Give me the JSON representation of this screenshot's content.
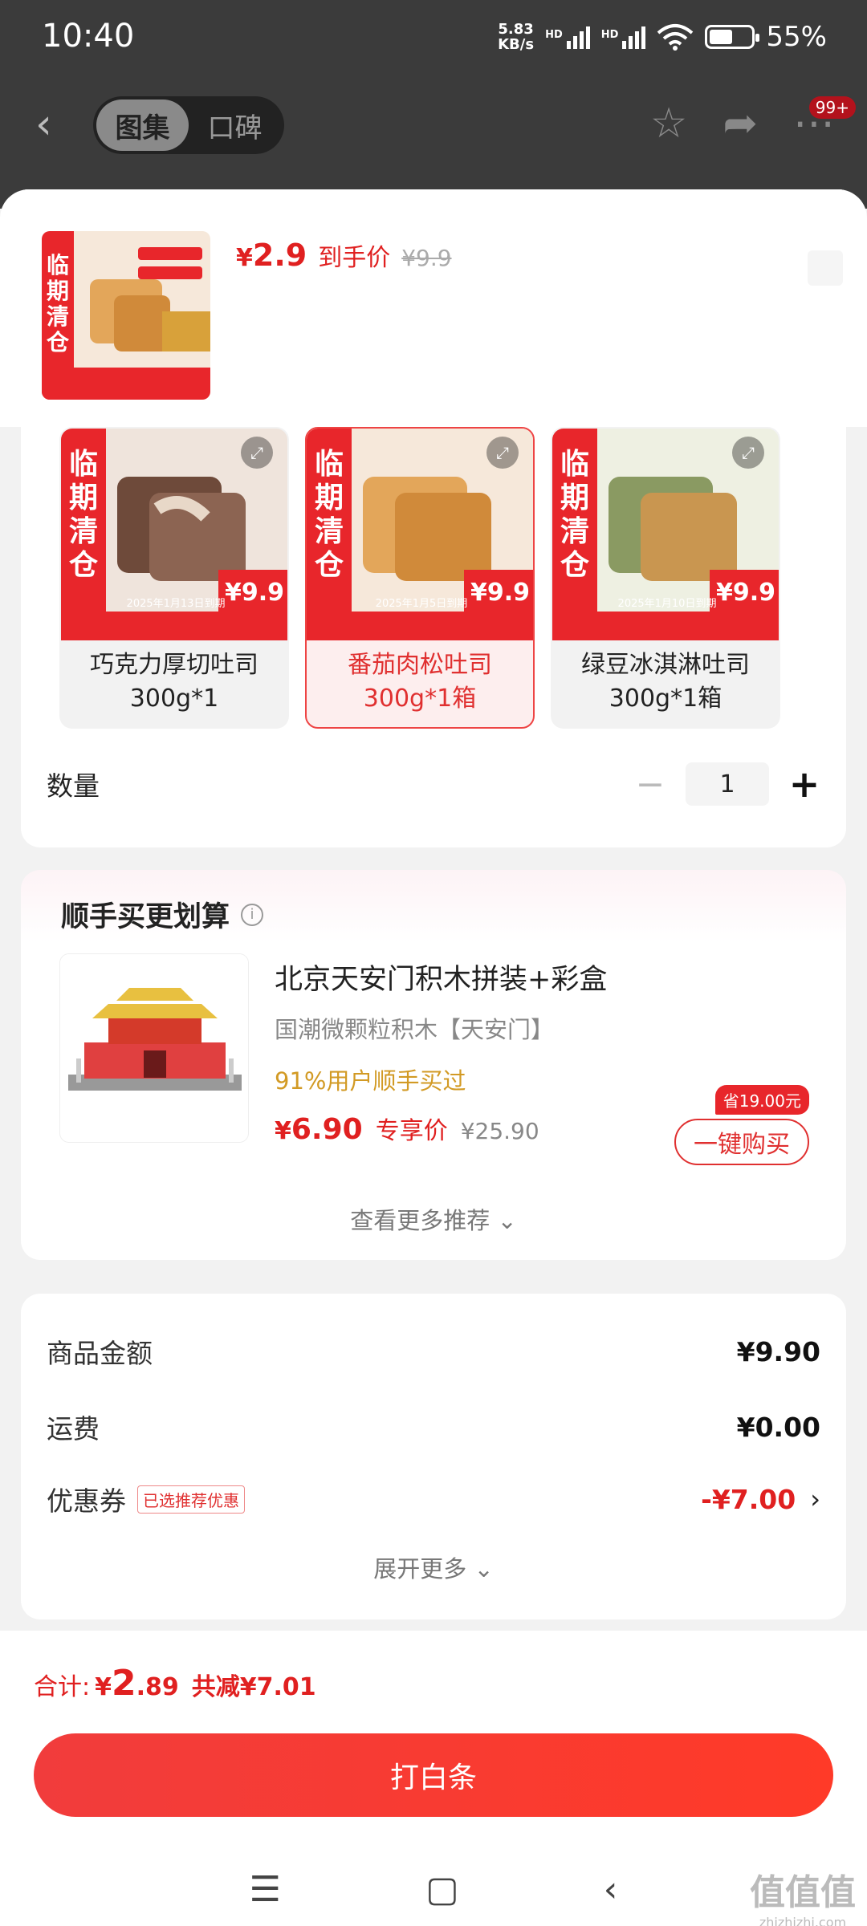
{
  "status_bar": {
    "time": "10:40",
    "net_speed_value": "5.83",
    "net_speed_unit": "KB/s",
    "hd_label": "HD",
    "battery": "55%"
  },
  "top_nav": {
    "tabs": [
      "图集",
      "口碑"
    ],
    "badge": "99+"
  },
  "product": {
    "price_currency": "¥",
    "price": "2.9",
    "price_tag": "到手价",
    "original_price": "¥9.9",
    "banner_text": "临期清仓"
  },
  "variants": [
    {
      "label": "巧克力厚切吐司\n300g*1",
      "banner": "临期清仓",
      "price_badge": "¥9.9",
      "expiry": "2025年1月13日到期"
    },
    {
      "label": "番茄肉松吐司\n300g*1箱",
      "banner": "临期清仓",
      "price_badge": "¥9.9",
      "expiry": "2025年1月5日到期"
    },
    {
      "label": "绿豆冰淇淋吐司\n300g*1箱",
      "banner": "临期清仓",
      "price_badge": "¥9.9",
      "expiry": "2025年1月10日到期"
    }
  ],
  "quantity": {
    "label": "数量",
    "value": "1"
  },
  "addon": {
    "section_title": "顺手买更划算",
    "title": "北京天安门积木拼装+彩盒",
    "subtitle": "国潮微颗粒积木【天安门】",
    "stat": "91%用户顺手买过",
    "price_currency": "¥",
    "price": "6.90",
    "price_tag": "专享价",
    "original_price": "¥25.90",
    "save_tag": "省19.00元",
    "buy_label": "一键购买",
    "more_label": "查看更多推荐"
  },
  "summary": {
    "rows": [
      {
        "label": "商品金额",
        "value": "¥9.90"
      },
      {
        "label": "运费",
        "value": "¥0.00"
      },
      {
        "label": "优惠券",
        "tag": "已选推荐优惠",
        "value": "-¥7.00"
      }
    ],
    "expand_label": "展开更多"
  },
  "bottom": {
    "total_label": "合计:",
    "total_currency": "¥",
    "total_int": "2",
    "total_dec": ".89",
    "total_saved": "共减¥7.01",
    "pay_label": "打白条"
  },
  "watermark": {
    "main": "值值值",
    "sub": "zhizhizhi.com"
  },
  "colors": {
    "accent": "#e02020",
    "gold": "#d29a24"
  }
}
